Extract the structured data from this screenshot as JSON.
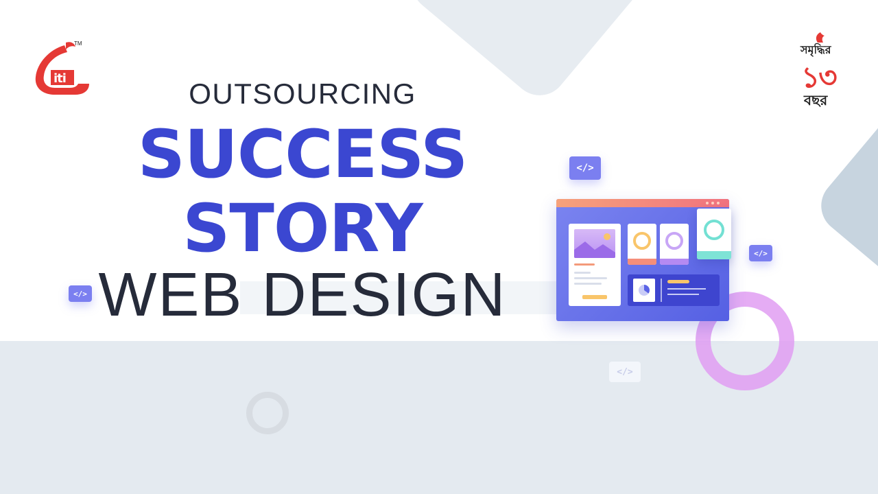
{
  "brand": {
    "left_logo_text": "iti",
    "left_logo_mark": "TM",
    "right_logo_line1": "সমৃদ্ধির",
    "right_logo_number": "১৩",
    "right_logo_line3": "বছর"
  },
  "headline": {
    "kicker": "OUTSOURCING",
    "line1": "SUCCESS",
    "line2": "STORY",
    "line3": "WEB DESIGN"
  },
  "code_chips": [
    "</>",
    "</>",
    "</>",
    "</>"
  ],
  "colors": {
    "accent": "#3b47d1",
    "dark_text": "#262b3a",
    "logo_red": "#e53935",
    "chip_purple": "#7b7ff0",
    "ring_purple": "#e09ef2"
  },
  "icons": [
    "code-icon",
    "image-icon",
    "pie-chart-icon",
    "ring-icon"
  ]
}
